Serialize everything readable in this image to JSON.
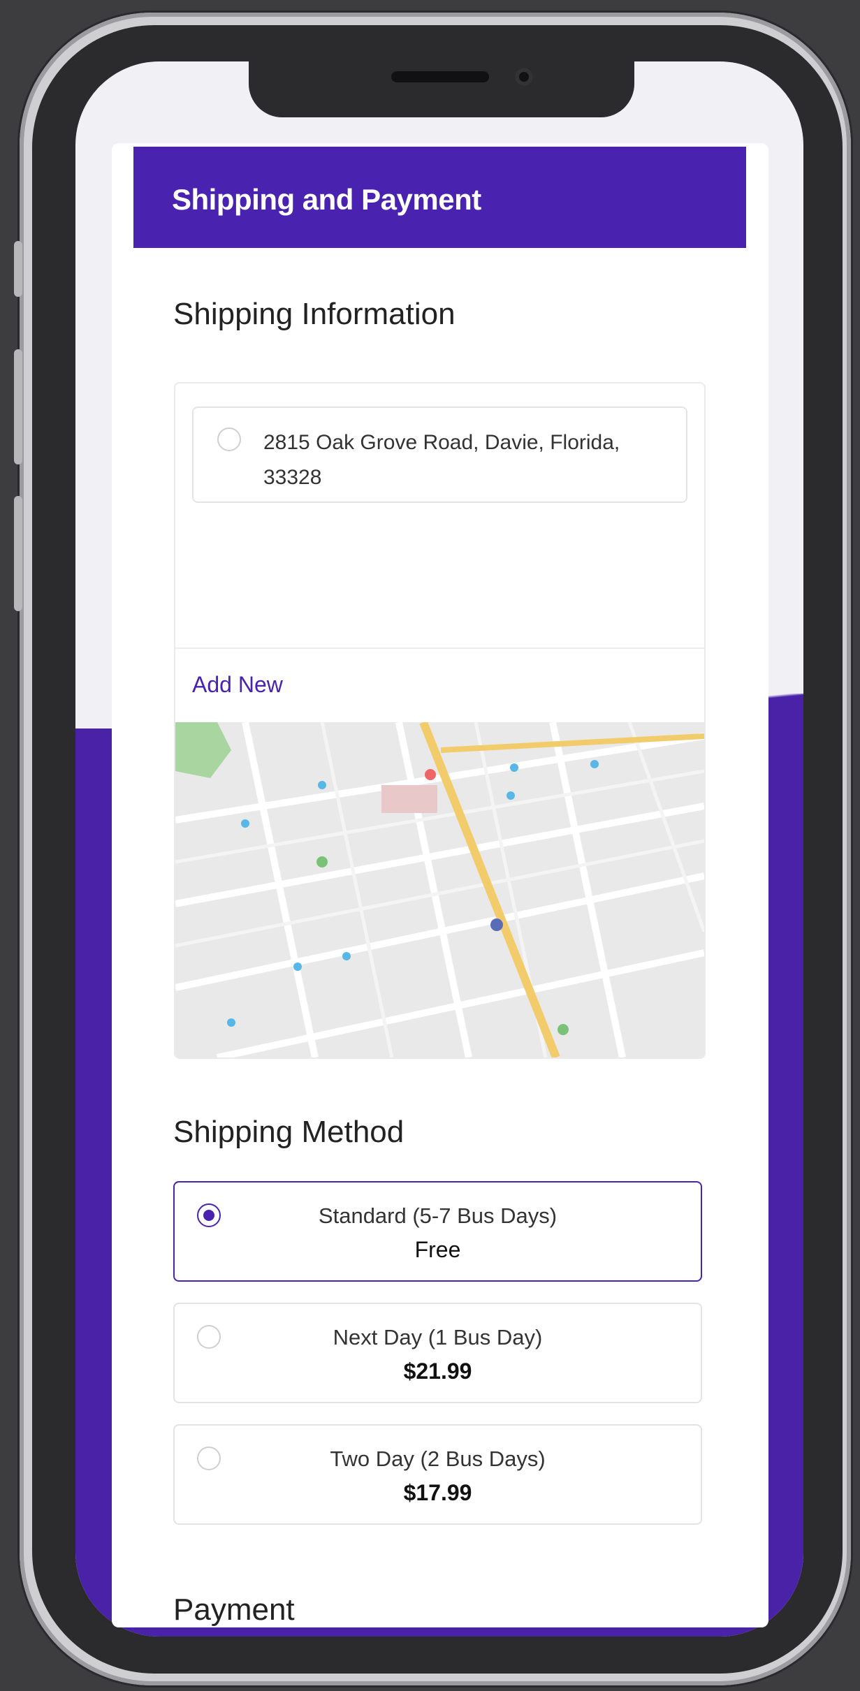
{
  "header": {
    "title": "Shipping and Payment"
  },
  "shipping_info": {
    "title": "Shipping Information",
    "address": "2815 Oak Grove Road, Davie, Florida, 33328",
    "add_new_label": "Add New"
  },
  "shipping_method": {
    "title": "Shipping Method",
    "options": [
      {
        "name": "Standard (5-7 Bus Days)",
        "price": "Free",
        "selected": true
      },
      {
        "name": "Next Day (1 Bus Day)",
        "price": "$21.99",
        "selected": false
      },
      {
        "name": "Two Day (2 Bus Days)",
        "price": "$17.99",
        "selected": false
      }
    ]
  },
  "payment": {
    "title": "Payment"
  },
  "colors": {
    "accent": "#4a22b0",
    "background": "#3d3d3f"
  },
  "icons": {
    "map": "map-image"
  }
}
